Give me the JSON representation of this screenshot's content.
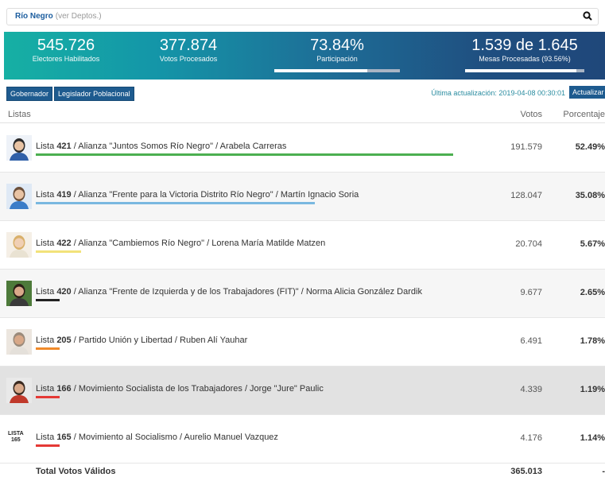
{
  "search": {
    "region": "Río Negro",
    "sublink": "(ver Deptos.)",
    "icon": "search-icon"
  },
  "stats": {
    "electores": {
      "value": "545.726",
      "label": "Electores Habilitados"
    },
    "votos": {
      "value": "377.874",
      "label": "Votos Procesados"
    },
    "participacion": {
      "value": "73.84%",
      "label": "Participación",
      "progress": 0.7384
    },
    "mesas": {
      "value": "1.539 de 1.645",
      "label": "Mesas Procesadas (93.56%)",
      "progress": 0.9356
    }
  },
  "tabs": [
    "Gobernador",
    "Legislador Poblacional"
  ],
  "update": {
    "text": "Última actualización: 2019-04-08 00:30:01",
    "button": "Actualizar"
  },
  "table": {
    "headers": [
      "Listas",
      "Votos",
      "Porcentaje"
    ],
    "rows": [
      {
        "num": "421",
        "desc": "Alianza \"Juntos Somos Río Negro\" / Arabela Carreras",
        "votes": "191.579",
        "pct": "52.49%",
        "color": "#4caf50",
        "share": 0.5249
      },
      {
        "num": "419",
        "desc": "Alianza \"Frente para la Victoria Distrito Río Negro\" / Martín Ignacio Soria",
        "votes": "128.047",
        "pct": "35.08%",
        "color": "#7ab8e0",
        "share": 0.3508
      },
      {
        "num": "422",
        "desc": "Alianza \"Cambiemos Río Negro\" / Lorena María Matilde Matzen",
        "votes": "20.704",
        "pct": "5.67%",
        "color": "#f2e27a",
        "share": 0.0567
      },
      {
        "num": "420",
        "desc": "Alianza \"Frente de Izquierda y de los Trabajadores (FIT)\" / Norma Alicia González Dardik",
        "votes": "9.677",
        "pct": "2.65%",
        "color": "#222222",
        "share": 0.0265
      },
      {
        "num": "205",
        "desc": "Partido Unión y Libertad / Ruben Alí Yauhar",
        "votes": "6.491",
        "pct": "1.78%",
        "color": "#f08a2a",
        "share": 0.0178
      },
      {
        "num": "166",
        "desc": "Movimiento Socialista de los Trabajadores / Jorge \"Jure\" Paulic",
        "votes": "4.339",
        "pct": "1.19%",
        "color": "#e53935",
        "share": 0.0119
      },
      {
        "num": "165",
        "desc": "Movimiento al Socialismo / Aurelio Manuel Vazquez",
        "votes": "4.176",
        "pct": "1.14%",
        "color": "#e53935",
        "share": 0.0114
      }
    ],
    "badge": [
      "LISTA",
      "165"
    ],
    "list_word": "Lista",
    "total": {
      "label": "Total Votos Válidos",
      "votes": "365.013",
      "pct": "-"
    }
  }
}
